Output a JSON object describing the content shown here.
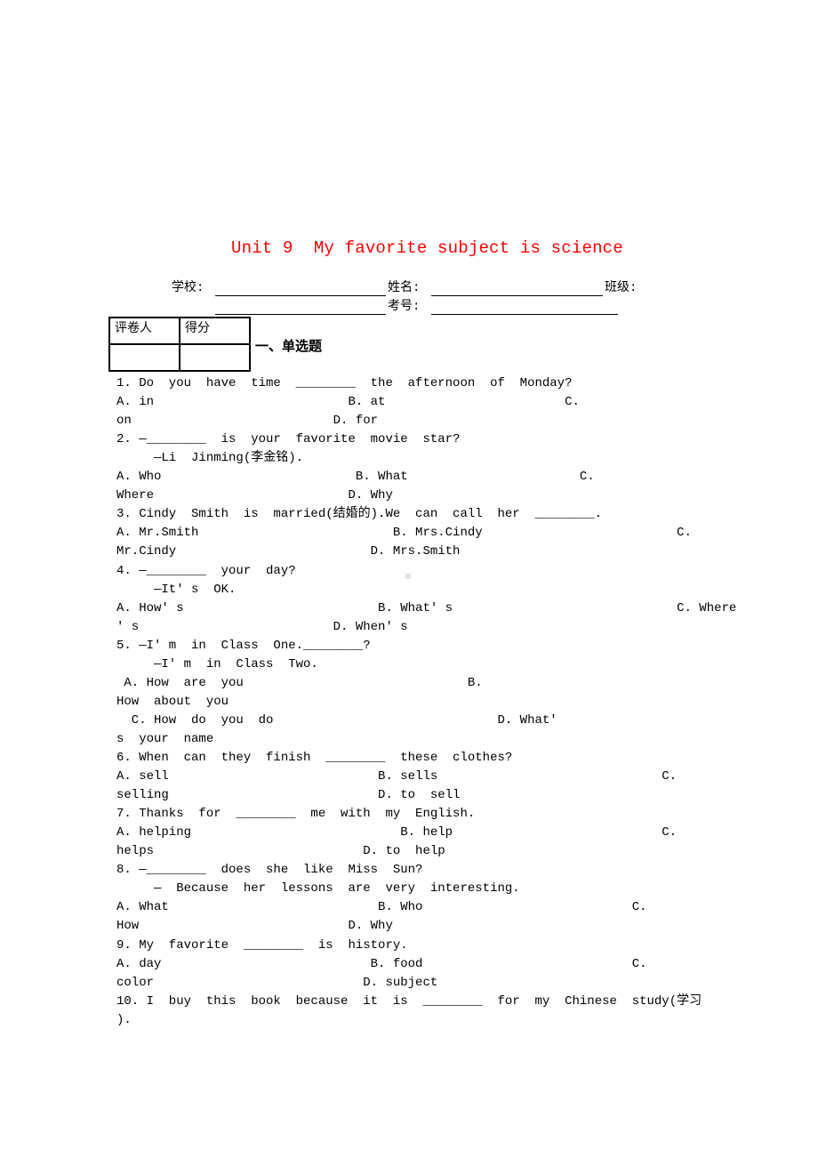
{
  "document": {
    "title": "Unit 9  My favorite subject is science",
    "title_color": "#ff0000",
    "header_fields": {
      "school": "学校:",
      "name": "姓名:",
      "class": "班级:",
      "exam_no": "考号:"
    },
    "score_table": {
      "headers": [
        "评卷人",
        "得分"
      ],
      "values": [
        "",
        ""
      ]
    },
    "section_title": "一、单选题",
    "lines": [
      "1. Do  you  have  time  ________  the  afternoon  of  Monday?",
      "A. in                          B. at                        C.",
      "on                           D. for",
      "2. —________  is  your  favorite  movie  star?",
      "     —Li  Jinming(李金铭).",
      "A. Who                          B. What                       C.",
      "Where                          D. Why",
      "3. Cindy  Smith  is  married(结婚的).We  can  call  her  ________.",
      "A. Mr.Smith                          B. Mrs.Cindy                          C.",
      "Mr.Cindy                          D. Mrs.Smith",
      "4. —________  your  day?",
      "     —It' s  OK.",
      "A. How' s                          B. What' s                              C. Where",
      "' s                          D. When' s",
      "5. —I' m  in  Class  One.________?",
      "     —I' m  in  Class  Two.",
      " A. How  are  you                              B.",
      "How  about  you",
      "  C. How  do  you  do                              D. What'",
      "s  your  name",
      "6. When  can  they  finish  ________  these  clothes?",
      "A. sell                            B. sells                              C.",
      "selling                            D. to  sell",
      "7. Thanks  for  ________  me  with  my  English.",
      "A. helping                            B. help                            C.",
      "helps                            D. to  help",
      "8. —________  does  she  like  Miss  Sun?",
      "     —  Because  her  lessons  are  very  interesting.",
      "A. What                            B. Who                            C.",
      "How                            D. Why",
      "9. My  favorite  ________  is  history.",
      "A. day                            B. food                            C.",
      "color                            D. subject",
      "10. I  buy  this  book  because  it  is  ________  for  my  Chinese  study(学习",
      ")."
    ]
  }
}
